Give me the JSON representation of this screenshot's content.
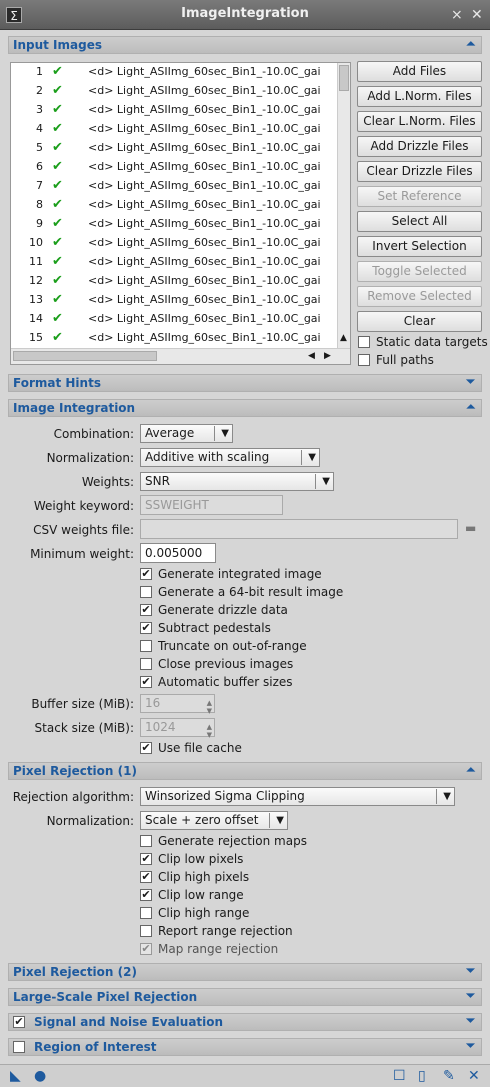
{
  "window": {
    "title": "ImageIntegration",
    "logo": "Σ"
  },
  "sections": {
    "input_images": "Input Images",
    "format_hints": "Format Hints",
    "image_integration": "Image Integration",
    "pixel_rejection_1": "Pixel Rejection (1)",
    "pixel_rejection_2": "Pixel Rejection (2)",
    "large_scale": "Large-Scale Pixel Rejection",
    "signal_noise": "Signal and Noise Evaluation",
    "roi": "Region of Interest"
  },
  "files": [
    {
      "n": "1",
      "name": "<d> Light_ASIImg_60sec_Bin1_-10.0C_gai"
    },
    {
      "n": "2",
      "name": "<d> Light_ASIImg_60sec_Bin1_-10.0C_gai"
    },
    {
      "n": "3",
      "name": "<d> Light_ASIImg_60sec_Bin1_-10.0C_gai"
    },
    {
      "n": "4",
      "name": "<d> Light_ASIImg_60sec_Bin1_-10.0C_gai"
    },
    {
      "n": "5",
      "name": "<d> Light_ASIImg_60sec_Bin1_-10.0C_gai"
    },
    {
      "n": "6",
      "name": "<d> Light_ASIImg_60sec_Bin1_-10.0C_gai"
    },
    {
      "n": "7",
      "name": "<d> Light_ASIImg_60sec_Bin1_-10.0C_gai"
    },
    {
      "n": "8",
      "name": "<d> Light_ASIImg_60sec_Bin1_-10.0C_gai"
    },
    {
      "n": "9",
      "name": "<d> Light_ASIImg_60sec_Bin1_-10.0C_gai"
    },
    {
      "n": "10",
      "name": "<d> Light_ASIImg_60sec_Bin1_-10.0C_gai"
    },
    {
      "n": "11",
      "name": "<d> Light_ASIImg_60sec_Bin1_-10.0C_gai"
    },
    {
      "n": "12",
      "name": "<d> Light_ASIImg_60sec_Bin1_-10.0C_gai"
    },
    {
      "n": "13",
      "name": "<d> Light_ASIImg_60sec_Bin1_-10.0C_gai"
    },
    {
      "n": "14",
      "name": "<d> Light_ASIImg_60sec_Bin1_-10.0C_gai"
    },
    {
      "n": "15",
      "name": "<d> Light_ASIImg_60sec_Bin1_-10.0C_gai"
    }
  ],
  "check_glyph": "✔",
  "buttons": {
    "add_files": "Add Files",
    "add_lnorm": "Add L.Norm. Files",
    "clear_lnorm": "Clear L.Norm. Files",
    "add_drizzle": "Add Drizzle Files",
    "clear_drizzle": "Clear Drizzle Files",
    "set_reference": "Set Reference",
    "select_all": "Select All",
    "invert_selection": "Invert Selection",
    "toggle_selected": "Toggle Selected",
    "remove_selected": "Remove Selected",
    "clear": "Clear"
  },
  "input_opts": {
    "static_targets": "Static data targets",
    "full_paths": "Full paths"
  },
  "integration": {
    "combination_label": "Combination:",
    "combination_value": "Average",
    "normalization_label": "Normalization:",
    "normalization_value": "Additive with scaling",
    "weights_label": "Weights:",
    "weights_value": "SNR",
    "weight_keyword_label": "Weight keyword:",
    "weight_keyword_value": "SSWEIGHT",
    "csv_label": "CSV weights file:",
    "csv_value": "",
    "min_weight_label": "Minimum weight:",
    "min_weight_value": "0.005000",
    "checks": [
      {
        "label": "Generate integrated image",
        "mark": "✔"
      },
      {
        "label": "Generate a 64-bit result image",
        "mark": ""
      },
      {
        "label": "Generate drizzle data",
        "mark": "✔"
      },
      {
        "label": "Subtract pedestals",
        "mark": "✔"
      },
      {
        "label": "Truncate on out-of-range",
        "mark": ""
      },
      {
        "label": "Close previous images",
        "mark": ""
      },
      {
        "label": "Automatic buffer sizes",
        "mark": "✔"
      }
    ],
    "buffer_label": "Buffer size (MiB):",
    "buffer_value": "16",
    "stack_label": "Stack size (MiB):",
    "stack_value": "1024",
    "file_cache_label": "Use file cache",
    "file_cache_mark": "✔"
  },
  "rejection": {
    "algorithm_label": "Rejection algorithm:",
    "algorithm_value": "Winsorized Sigma Clipping",
    "normalization_label": "Normalization:",
    "normalization_value": "Scale + zero offset",
    "checks": [
      {
        "label": "Generate rejection maps",
        "mark": ""
      },
      {
        "label": "Clip low pixels",
        "mark": "✔"
      },
      {
        "label": "Clip high pixels",
        "mark": "✔"
      },
      {
        "label": "Clip low range",
        "mark": "✔"
      },
      {
        "label": "Clip high range",
        "mark": ""
      },
      {
        "label": "Report range rejection",
        "mark": ""
      },
      {
        "label": "Map range rejection",
        "mark": "✔"
      }
    ]
  },
  "signal_noise_mark": "✔",
  "roi_mark": ""
}
